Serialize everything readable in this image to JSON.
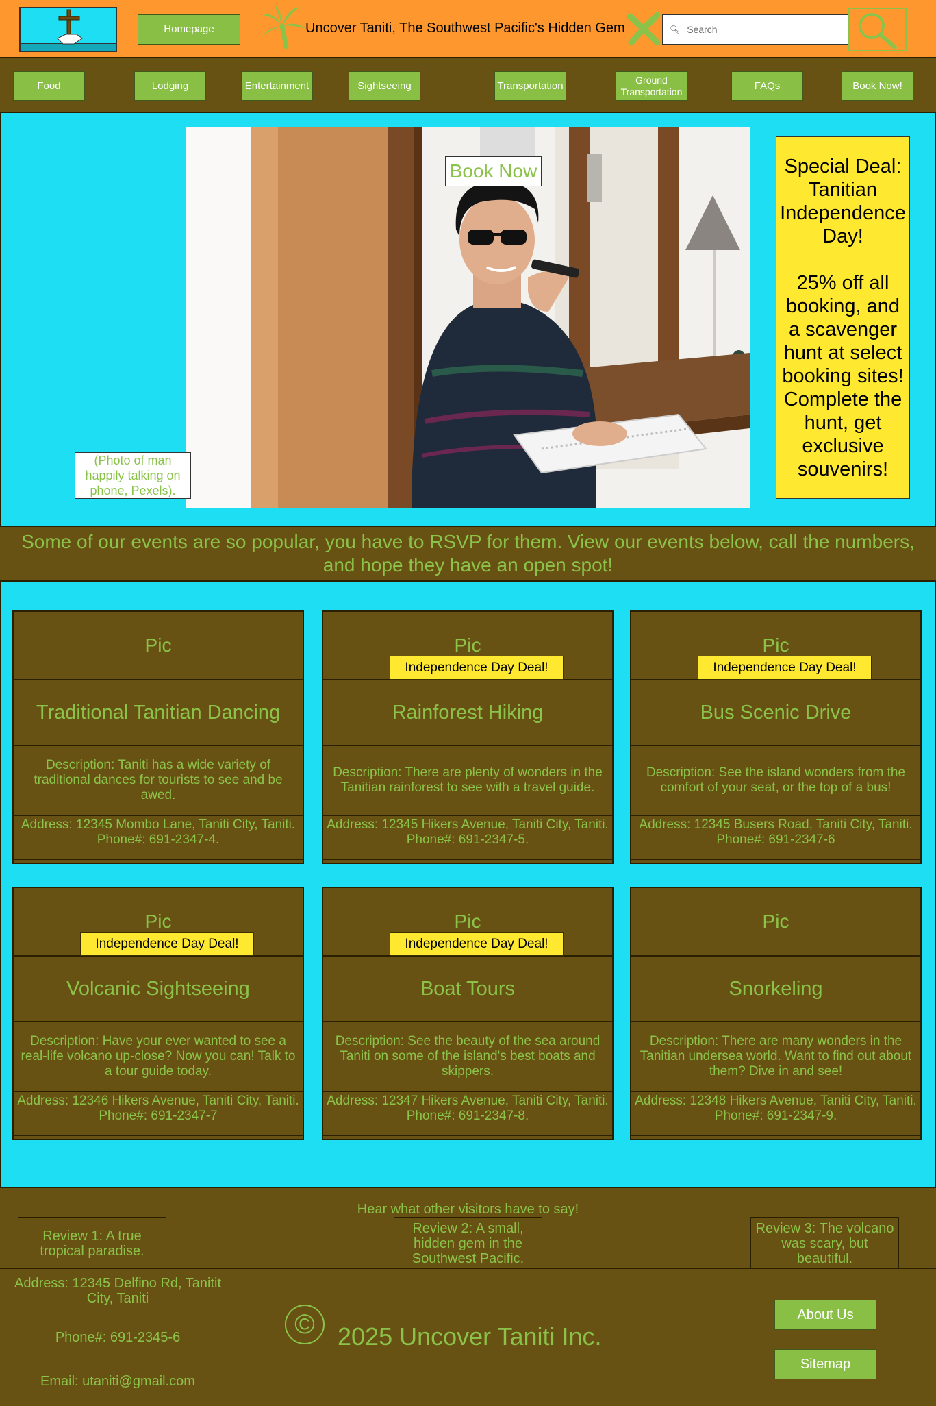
{
  "header": {
    "homepage_label": "Homepage",
    "site_title": "Uncover Taniti, The Southwest Pacific's Hidden Gem",
    "search_placeholder": "Search"
  },
  "nav": {
    "items": [
      "Food",
      "Lodging",
      "Entertainment",
      "Sightseeing",
      "Transportation",
      "Ground Transportation",
      "FAQs",
      "Book Now!"
    ]
  },
  "hero": {
    "book_now_label": "Book Now",
    "photo_caption": "(Photo of man happily talking on phone, Pexels).",
    "special_deal_title": "Special Deal: Tanitian Independence Day!",
    "special_deal_body": "25% off all booking, and a scavenger hunt at select booking sites! Complete the hunt, get exclusive souvenirs!"
  },
  "rsvp_banner": "Some of our events are so popular, you have to RSVP for them. View our events below, call the numbers, and hope they have an open spot!",
  "events": [
    {
      "pic": "Pic",
      "deal": "",
      "title": "Traditional Tanitian Dancing",
      "description": "Description: Taniti has a wide variety of traditional dances for tourists to see and be awed.",
      "address": "Address: 12345 Mombo Lane, Taniti City, Taniti. Phone#: 691-2347-4."
    },
    {
      "pic": "Pic",
      "deal": "Independence Day Deal!",
      "title": "Rainforest Hiking",
      "description": "Description: There are plenty of wonders in the Tanitian rainforest to see with a travel guide.",
      "address": "Address: 12345 Hikers Avenue, Taniti City, Taniti. Phone#: 691-2347-5."
    },
    {
      "pic": "Pic",
      "deal": "Independence Day Deal!",
      "title": "Bus Scenic Drive",
      "description": "Description: See the island wonders from the comfort of your seat, or the top of a bus!",
      "address": "Address: 12345 Busers Road, Taniti City, Taniti. Phone#: 691-2347-6"
    },
    {
      "pic": "Pic",
      "deal": "Independence Day Deal!",
      "title": "Volcanic Sightseeing",
      "description": "Description: Have your ever wanted to see a real-life volcano up-close? Now you can! Talk to a tour guide today.",
      "address": "Address: 12346 Hikers Avenue, Taniti City, Taniti. Phone#: 691-2347-7"
    },
    {
      "pic": "Pic",
      "deal": "Independence Day Deal!",
      "title": "Boat Tours",
      "description": "Description: See the beauty of the sea around Taniti on some of the island's best boats and skippers.",
      "address": "Address: 12347 Hikers Avenue, Taniti City, Taniti. Phone#: 691-2347-8."
    },
    {
      "pic": "Pic",
      "deal": "",
      "title": "Snorkeling",
      "description": "Description: There are many wonders in the Tanitian undersea world. Want to find out about them? Dive in and see!",
      "address": "Address: 12348 Hikers Avenue, Taniti City, Taniti. Phone#: 691-2347-9."
    }
  ],
  "reviews": {
    "heading": "Hear what other visitors have to say!",
    "items": [
      "Review 1: A true tropical paradise.",
      "Review 2: A small, hidden gem in the Southwest Pacific.",
      "Review 3: The volcano was scary, but beautiful."
    ]
  },
  "footer": {
    "address": "Address: 12345 Delfino Rd, Tanitit City, Taniti",
    "phone": "Phone#: 691-2345-6",
    "email": "Email: utaniti@gmail.com",
    "copyright_symbol": "©",
    "copyright": "2025 Uncover Taniti Inc.",
    "about_label": "About Us",
    "sitemap_label": "Sitemap"
  },
  "colors": {
    "header_orange": "#ff972f",
    "page_cyan": "#1edef3",
    "olive": "#685213",
    "button_green": "#8abf46",
    "text_green": "#8bc34a",
    "deal_yellow": "#ffe930"
  }
}
